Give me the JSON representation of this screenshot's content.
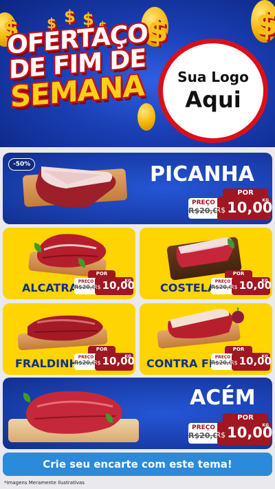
{
  "header": {
    "title_lines": [
      "OFERTAÇO",
      "DE FIM DE",
      "SEMANA"
    ],
    "logo_line1": "Sua Logo",
    "logo_line2": "Aqui",
    "dollar_symbol": "$"
  },
  "featured": {
    "name": "PICANHA",
    "discount_badge": "-50%",
    "por_label": "POR",
    "preco_label": "PREÇO",
    "old_price": "R$20,00",
    "currency": "R$",
    "price": "10,00",
    "unit": "KG"
  },
  "products": [
    {
      "name": "ALCATRA",
      "por_label": "POR",
      "preco_label": "PREÇO",
      "old_price": "R$20,00",
      "currency": "R$",
      "price": "10,00",
      "unit": "KG"
    },
    {
      "name": "COSTELA",
      "por_label": "POR",
      "preco_label": "PREÇO",
      "old_price": "R$20,00",
      "currency": "R$",
      "price": "10,00",
      "unit": "KG"
    },
    {
      "name": "FRALDINHA",
      "por_label": "POR",
      "preco_label": "PREÇO",
      "old_price": "R$20,00",
      "currency": "R$",
      "price": "10,00",
      "unit": "KG"
    },
    {
      "name": "CONTRA FILÉ",
      "por_label": "POR",
      "preco_label": "PREÇO",
      "old_price": "R$20,00",
      "currency": "R$",
      "price": "10,00",
      "unit": "KG"
    }
  ],
  "bottom_featured": {
    "name": "ACÉM",
    "por_label": "POR",
    "preco_label": "PREÇO",
    "old_price": "R$20,00",
    "currency": "R$",
    "price": "10,00",
    "unit": "KG"
  },
  "banner": {
    "text": "Crie seu encarte com este tema!"
  },
  "footnote": "*Imagens Meramente Ilustrativas",
  "colors": {
    "header_blue": "#1a3fb5",
    "card_yellow": "#ffd400",
    "price_red": "#a01621",
    "banner_blue": "#2b8ad9",
    "title_yellow": "#ffcf1a"
  }
}
